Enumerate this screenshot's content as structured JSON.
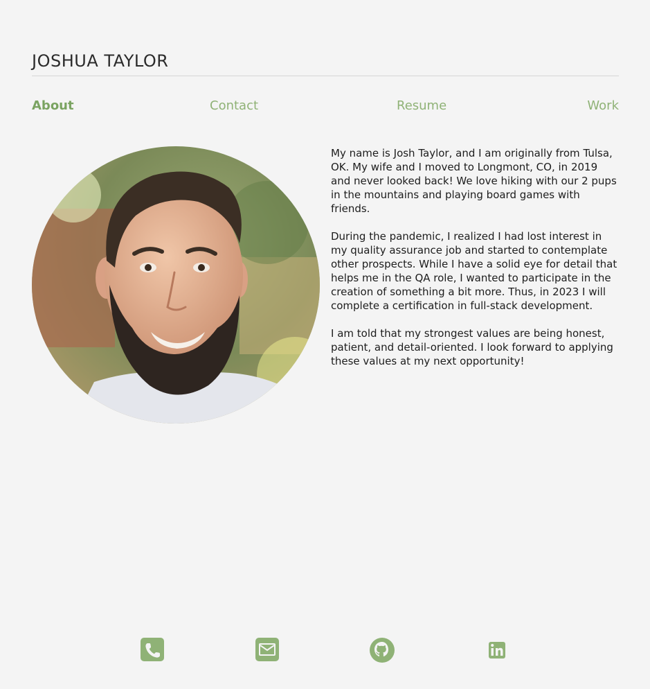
{
  "header": {
    "title": "JOSHUA TAYLOR"
  },
  "nav": {
    "items": [
      {
        "label": "About",
        "active": true
      },
      {
        "label": "Contact",
        "active": false
      },
      {
        "label": "Resume",
        "active": false
      },
      {
        "label": "Work",
        "active": false
      }
    ]
  },
  "about": {
    "photo_icon": "portrait-photo",
    "paragraphs": [
      "My name is Josh Taylor, and I am originally from Tulsa, OK. My wife and I moved to Longmont, CO, in 2019 and never looked back! We love hiking with our 2 pups in the mountains and playing board games with friends.",
      "During the pandemic, I realized I had lost interest in my quality assurance job and started to contemplate other prospects. While I have a solid eye for detail that helps me in the QA role, I wanted to participate in the creation of something a bit more. Thus, in 2023 I will complete a certification in full-stack development.",
      "I am told that my strongest values are being honest, patient, and detail-oriented. I look forward to applying these values at my next opportunity!"
    ]
  },
  "footer": {
    "icons": [
      "phone-icon",
      "email-icon",
      "github-icon",
      "linkedin-icon"
    ]
  },
  "colors": {
    "accent": "#8fb276",
    "accent_active": "#7aa361",
    "background": "#f4f4f4",
    "text": "#1d1d1d"
  }
}
